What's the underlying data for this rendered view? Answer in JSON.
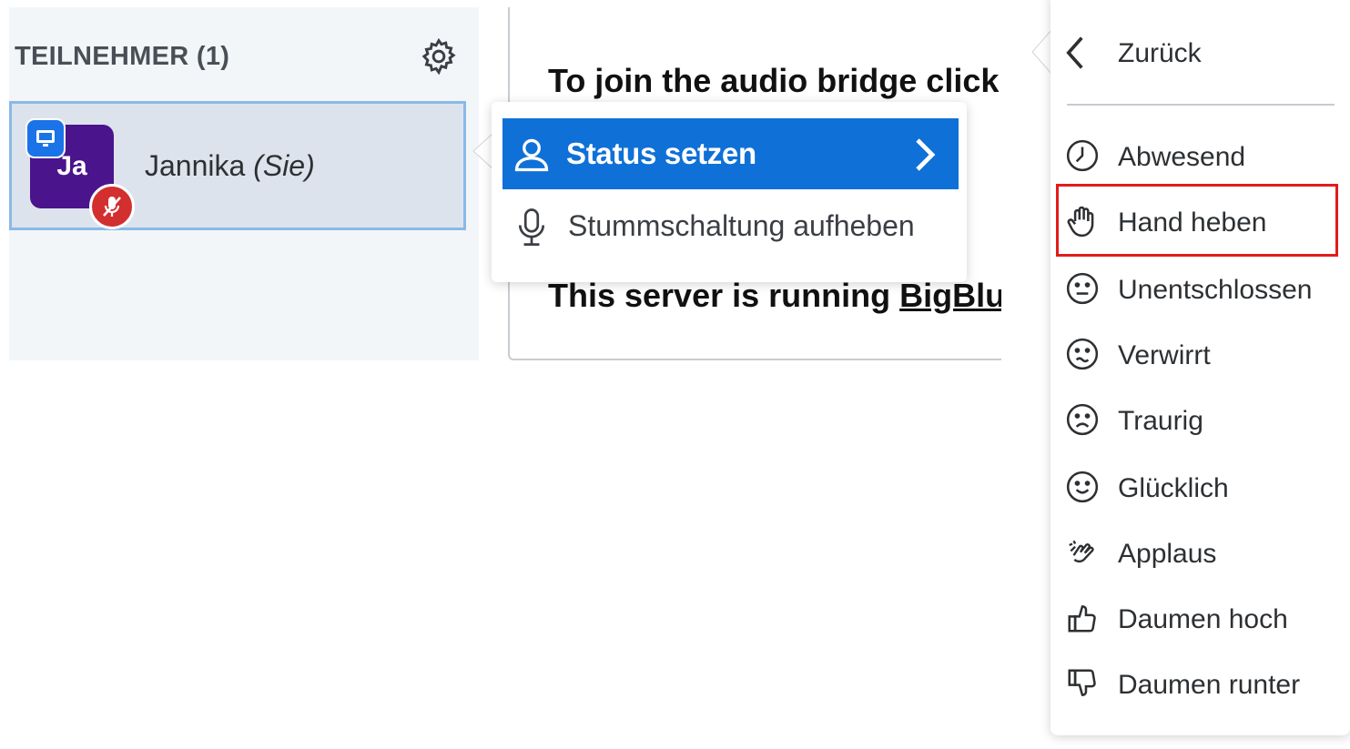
{
  "participants": {
    "header": "TEILNEHMER (1)",
    "user": {
      "initials": "Ja",
      "name": "Jannika",
      "you_suffix": "(Sie)"
    }
  },
  "welcome": {
    "line1": "To join the audio bridge click",
    "line2_prefix": "This server is running ",
    "line2_link": "BigBlue"
  },
  "context_menu": {
    "status_label": "Status setzen",
    "unmute_label": "Stummschaltung aufheben"
  },
  "status_menu": {
    "back_label": "Zurück",
    "items": [
      {
        "label": "Abwesend",
        "icon": "clock-icon"
      },
      {
        "label": "Hand heben",
        "icon": "hand-icon"
      },
      {
        "label": "Unentschlossen",
        "icon": "neutral-face-icon"
      },
      {
        "label": "Verwirrt",
        "icon": "confused-face-icon"
      },
      {
        "label": "Traurig",
        "icon": "sad-face-icon"
      },
      {
        "label": "Glücklich",
        "icon": "happy-face-icon"
      },
      {
        "label": "Applaus",
        "icon": "applause-icon"
      },
      {
        "label": "Daumen hoch",
        "icon": "thumbs-up-icon"
      },
      {
        "label": "Daumen runter",
        "icon": "thumbs-down-icon"
      }
    ]
  },
  "colors": {
    "accent": "#0f70d7",
    "avatar": "#4a148c",
    "muted": "#d32f2f",
    "highlight": "#e31b1b"
  }
}
